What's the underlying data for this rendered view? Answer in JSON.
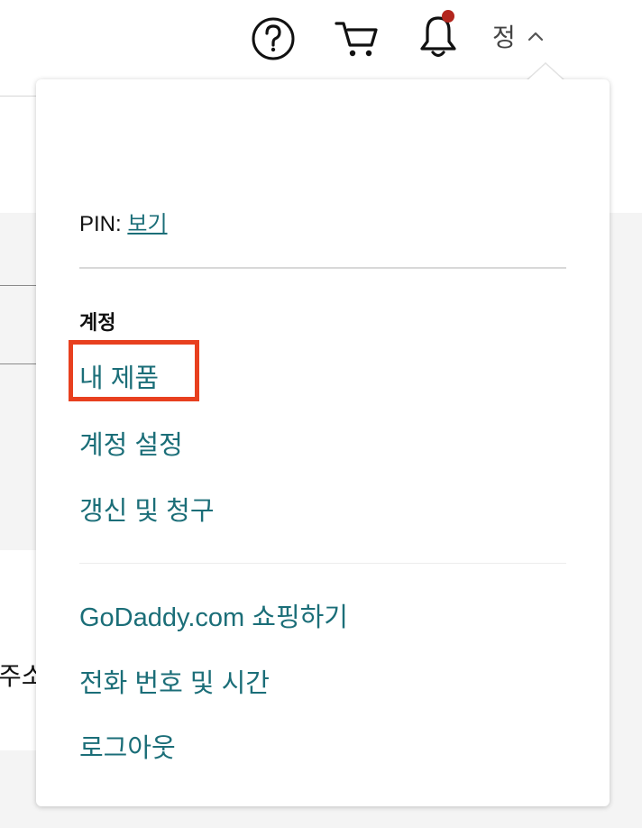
{
  "background": {
    "partial_text": "주소"
  },
  "header": {
    "help_icon": "help-circle-icon",
    "cart_icon": "cart-icon",
    "bell_icon": "bell-icon",
    "account_initial": "정",
    "notification_dot_color": "#b3261e"
  },
  "dropdown": {
    "pin_label": "PIN:",
    "pin_link": "보기",
    "account_section_label": "계정",
    "account_links": {
      "my_products": "내 제품",
      "account_settings": "계정 설정",
      "renewals_billing": "갱신 및 청구"
    },
    "other_links": {
      "shop": "GoDaddy.com 쇼핑하기",
      "phone_hours": "전화 번호 및 시간",
      "logout": "로그아웃"
    },
    "link_color": "#1b6e78",
    "highlight_color": "#e8401f"
  }
}
